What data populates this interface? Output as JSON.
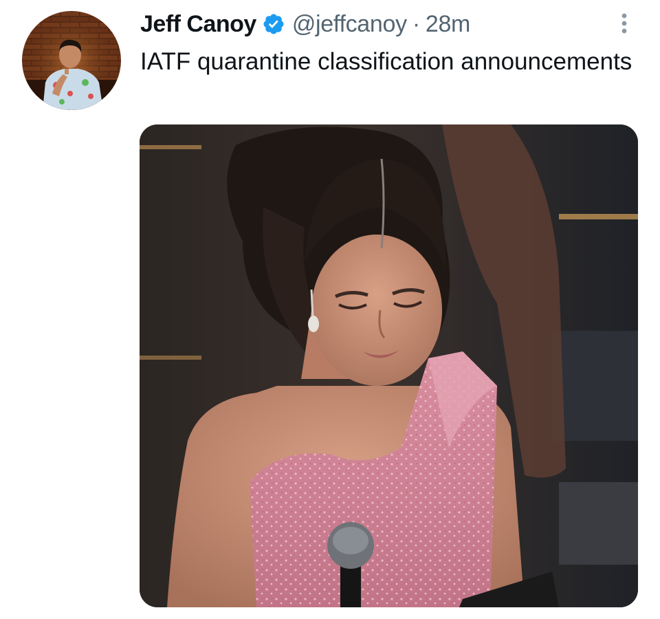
{
  "tweet": {
    "author_name": "Jeff Canoy",
    "verified": true,
    "handle": "@jeffcanoy",
    "separator": "·",
    "time": "28m",
    "text": "IATF quarantine classification announcements",
    "more_icon": "more-vertical-icon",
    "verified_icon": "verified-badge-icon",
    "accent_color": "#1d9bf0"
  },
  "media": {
    "type": "photo"
  }
}
